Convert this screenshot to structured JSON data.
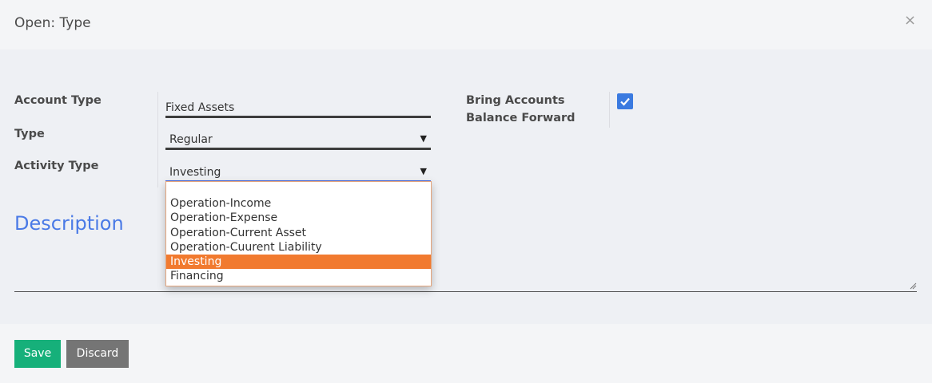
{
  "dialog": {
    "title": "Open: Type",
    "close_symbol": "×"
  },
  "form": {
    "account_type": {
      "label": "Account Type",
      "value": "Fixed Assets"
    },
    "type": {
      "label": "Type",
      "value": "Regular",
      "arrow": "▼"
    },
    "activity_type": {
      "label": "Activity Type",
      "value": "Investing",
      "arrow": "▼"
    },
    "bring_forward": {
      "label_line1": "Bring Accounts",
      "label_line2": "Balance Forward",
      "checked": true
    }
  },
  "activity_dropdown": {
    "options": [
      "Operation-Income",
      "Operation-Expense",
      "Operation-Current Asset",
      "Operation-Cuurent Liability",
      "Investing",
      "Financing"
    ],
    "selected": "Investing"
  },
  "description": {
    "title": "Description"
  },
  "footer": {
    "save_label": "Save",
    "discard_label": "Discard"
  },
  "colors": {
    "accent_blue": "#4a7ae6",
    "checkbox_blue": "#3a7ae0",
    "highlight_orange": "#f17a2f",
    "save_green": "#16b07a",
    "discard_gray": "#757575"
  }
}
